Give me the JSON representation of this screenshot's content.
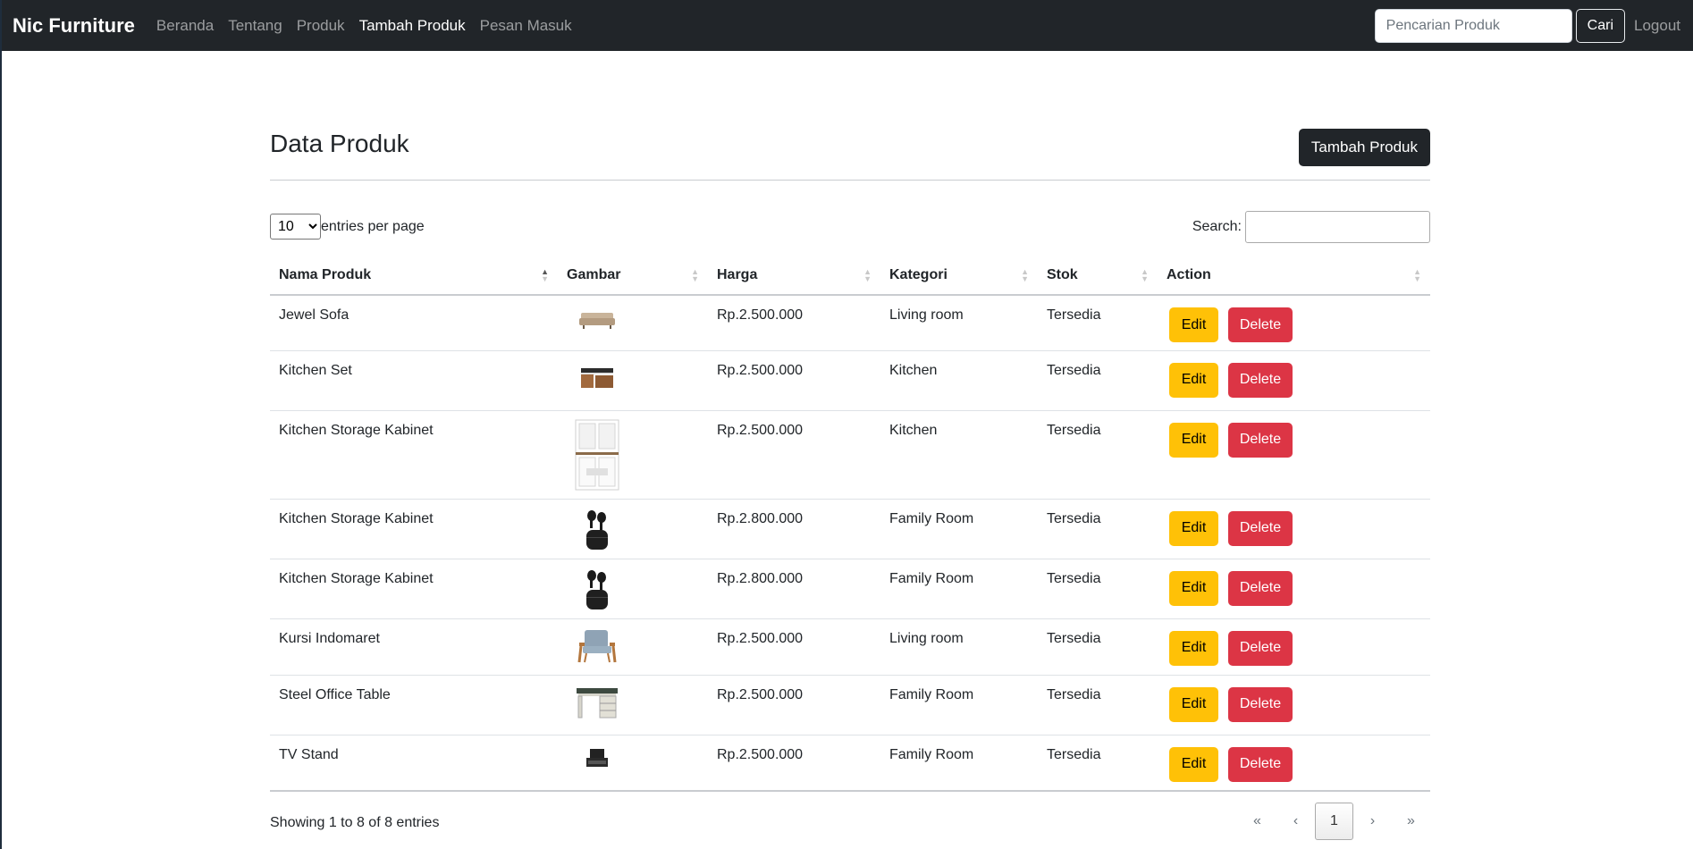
{
  "navbar": {
    "brand": "Nic Furniture",
    "links": [
      "Beranda",
      "Tentang",
      "Produk",
      "Tambah Produk",
      "Pesan Masuk"
    ],
    "active_link": "Tambah Produk",
    "search_placeholder": "Pencarian Produk",
    "search_button": "Cari",
    "logout": "Logout"
  },
  "page": {
    "title": "Data Produk",
    "add_button": "Tambah Produk"
  },
  "datatable": {
    "per_page_value": "10",
    "per_page_label": "entries per page",
    "search_label": "Search:",
    "columns": [
      "Nama Produk",
      "Gambar",
      "Harga",
      "Kategori",
      "Stok",
      "Action"
    ],
    "sorted_column": "Nama Produk",
    "sort_direction": "ascending",
    "rows": [
      {
        "name": "Jewel Sofa",
        "image": "sofa-icon",
        "price": "Rp.2.500.000",
        "category": "Living room",
        "stock": "Tersedia"
      },
      {
        "name": "Kitchen Set",
        "image": "kitchen-set-icon",
        "price": "Rp.2.500.000",
        "category": "Kitchen",
        "stock": "Tersedia"
      },
      {
        "name": "Kitchen Storage Kabinet",
        "image": "cabinet-icon",
        "price": "Rp.2.500.000",
        "category": "Kitchen",
        "stock": "Tersedia"
      },
      {
        "name": "Kitchen Storage Kabinet",
        "image": "earbuds-icon",
        "price": "Rp.2.800.000",
        "category": "Family Room",
        "stock": "Tersedia"
      },
      {
        "name": "Kitchen Storage Kabinet",
        "image": "earbuds-icon",
        "price": "Rp.2.800.000",
        "category": "Family Room",
        "stock": "Tersedia"
      },
      {
        "name": "Kursi Indomaret",
        "image": "armchair-icon",
        "price": "Rp.2.500.000",
        "category": "Living room",
        "stock": "Tersedia"
      },
      {
        "name": "Steel Office Table",
        "image": "office-desk-icon",
        "price": "Rp.2.500.000",
        "category": "Family Room",
        "stock": "Tersedia"
      },
      {
        "name": "TV Stand",
        "image": "tv-stand-icon",
        "price": "Rp.2.500.000",
        "category": "Family Room",
        "stock": "Tersedia"
      }
    ],
    "edit_label": "Edit",
    "delete_label": "Delete",
    "info": "Showing 1 to 8 of 8 entries",
    "pagination": {
      "first": "«",
      "prev": "‹",
      "current": "1",
      "next": "›",
      "last": "»"
    }
  },
  "colors": {
    "navbar_bg": "#212529",
    "edit_button": "#ffc107",
    "delete_button": "#dc3545",
    "primary_dark": "#212529"
  }
}
